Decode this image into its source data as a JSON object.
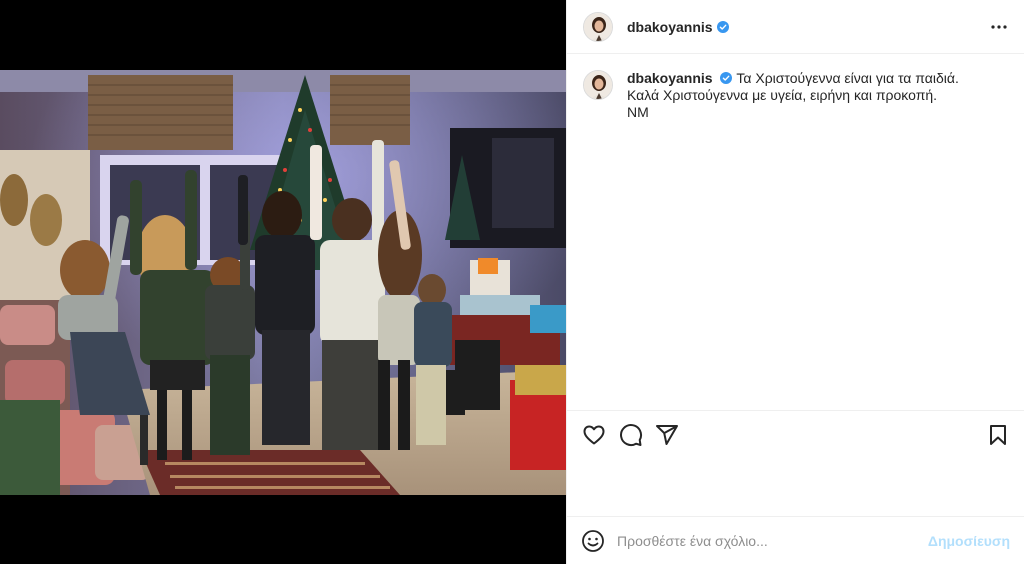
{
  "post": {
    "username": "dbakoyannis",
    "verified": true,
    "caption_lines": [
      "Τα Χριστούγεννα είναι για τα παιδιά.",
      "Καλά Χριστούγεννα με υγεία, ειρήνη και προκοπή.",
      "ΝΜ"
    ]
  },
  "header": {
    "username": "dbakoyannis",
    "more_icon": "more-horizontal-icon"
  },
  "actions": {
    "like_icon": "heart-icon",
    "comment_icon": "comment-icon",
    "share_icon": "send-icon",
    "save_icon": "bookmark-icon"
  },
  "comment_bar": {
    "emoji_icon": "emoji-icon",
    "placeholder": "Προσθέστε ένα σχόλιο...",
    "publish_label": "Δημοσίευση"
  },
  "colors": {
    "verified": "#3897f0",
    "publish_disabled": "#b2dffc",
    "border": "#efefef"
  }
}
